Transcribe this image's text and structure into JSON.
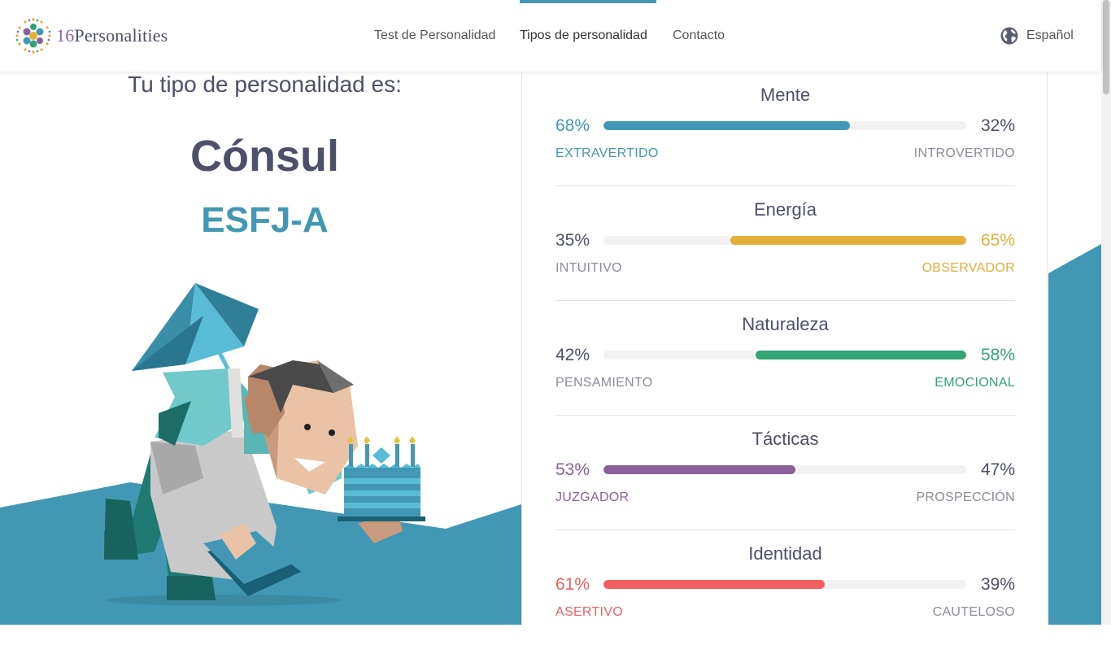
{
  "header": {
    "logo_prefix": "16",
    "logo_name": "Personalities",
    "nav": [
      {
        "label": "Test de Personalidad"
      },
      {
        "label": "Tipos de personalidad"
      },
      {
        "label": "Contacto"
      }
    ],
    "language": "Español",
    "icons": {
      "language": "globe-icon"
    }
  },
  "result": {
    "intro": "Tu tipo de personalidad es:",
    "type_name": "Cónsul",
    "type_code": "ESFJ-A"
  },
  "traits": [
    {
      "title": "Mente",
      "left_pct": "68%",
      "right_pct": "32%",
      "left_label": "EXTRAVERTIDO",
      "right_label": "INTROVERTIDO",
      "dominant": "left",
      "value": 0.68,
      "color": "#4298b4"
    },
    {
      "title": "Energía",
      "left_pct": "35%",
      "right_pct": "65%",
      "left_label": "INTUITIVO",
      "right_label": "OBSERVADOR",
      "dominant": "right",
      "value": 0.65,
      "color": "#e4ae3a"
    },
    {
      "title": "Naturaleza",
      "left_pct": "42%",
      "right_pct": "58%",
      "left_label": "PENSAMIENTO",
      "right_label": "EMOCIONAL",
      "dominant": "right",
      "value": 0.58,
      "color": "#33a474"
    },
    {
      "title": "Tácticas",
      "left_pct": "53%",
      "right_pct": "47%",
      "left_label": "JUZGADOR",
      "right_label": "PROSPECCIÓN",
      "dominant": "left",
      "value": 0.53,
      "color": "#88619a"
    },
    {
      "title": "Identidad",
      "left_pct": "61%",
      "right_pct": "39%",
      "left_label": "ASERTIVO",
      "right_label": "CAUTELOSO",
      "dominant": "left",
      "value": 0.61,
      "color": "#f25e62"
    }
  ],
  "colors": {
    "accent": "#4298b4",
    "text": "#4c5068"
  }
}
